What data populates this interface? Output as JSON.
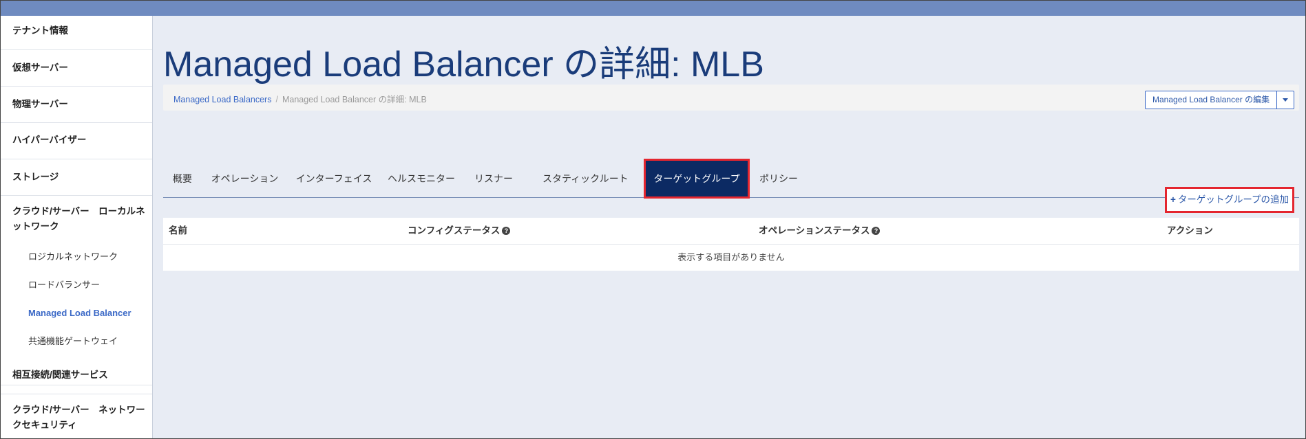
{
  "sidebar": {
    "items": [
      {
        "label": "テナント情報"
      },
      {
        "label": "仮想サーバー"
      },
      {
        "label": "物理サーバー"
      },
      {
        "label": "ハイパーバイザー"
      },
      {
        "label": "ストレージ"
      },
      {
        "label_line1": "クラウド/サーバー　ローカルネ",
        "label_line2": "ットワーク"
      },
      {
        "label": "相互接続/関連サービス"
      },
      {
        "label_line1": "クラウド/サーバー　ネットワー",
        "label_line2": "クセキュリティ"
      }
    ],
    "sub_items": [
      {
        "label": "ロジカルネットワーク"
      },
      {
        "label": "ロードバランサー"
      },
      {
        "label": "Managed Load Balancer",
        "active": true
      },
      {
        "label": "共通機能ゲートウェイ"
      }
    ]
  },
  "page": {
    "title": "Managed Load Balancer の詳細: MLB",
    "breadcrumb": {
      "link": "Managed Load Balancers",
      "separator": "/",
      "current": "Managed Load Balancer の詳細: MLB"
    },
    "edit_button": "Managed Load Balancer の編集",
    "caret_icon": "caret-down-icon"
  },
  "tabs": [
    {
      "label": "概要"
    },
    {
      "label": "オペレーション"
    },
    {
      "label": "インターフェイス"
    },
    {
      "label": "ヘルスモニター"
    },
    {
      "label": "リスナー"
    },
    {
      "label": "スタティックルート"
    },
    {
      "label": "ターゲットグループ",
      "active": true
    },
    {
      "label": "ポリシー"
    }
  ],
  "actions": {
    "add_icon": "+",
    "add_label": "ターゲットグループの追加"
  },
  "table": {
    "headers": {
      "name": "名前",
      "config_status": "コンフィグステータス",
      "operation_status": "オペレーションステータス",
      "action": "アクション"
    },
    "help_glyph": "?",
    "empty_message": "表示する項目がありません"
  },
  "colors": {
    "accent": "#3a68c6",
    "title": "#1a3c7a",
    "active_tab_bg": "#0c2a63",
    "highlight": "#e4262f",
    "topbar": "#6f8bc0"
  }
}
